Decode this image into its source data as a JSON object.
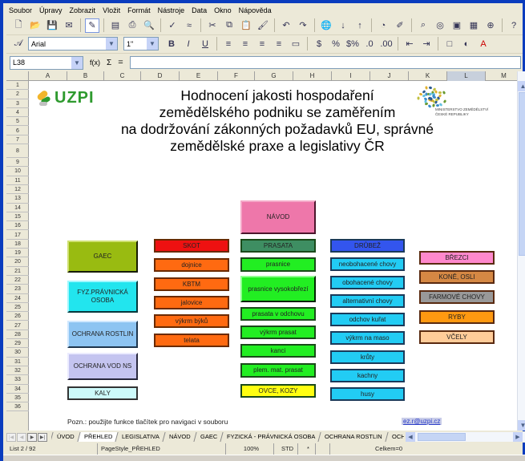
{
  "menu": [
    "Soubor",
    "Úpravy",
    "Zobrazit",
    "Vložit",
    "Formát",
    "Nástroje",
    "Data",
    "Okno",
    "Nápověda"
  ],
  "toolbar": {
    "standard_icons": [
      "new-icon",
      "open-icon",
      "save-icon",
      "email-icon",
      "edit-mode-icon",
      "export-pdf-icon",
      "print-icon",
      "page-preview-icon",
      "spellcheck-icon",
      "autospell-icon",
      "cut-icon",
      "copy-icon",
      "paste-icon",
      "format-paintbrush-icon",
      "undo-icon",
      "redo-icon",
      "hyperlink-icon",
      "sort-ascending-icon",
      "sort-descending-icon",
      "chart-icon",
      "draw-functions-icon",
      "find-icon",
      "navigator-icon",
      "gallery-icon",
      "datasources-icon",
      "zoom-icon",
      "help-icon"
    ],
    "font_name": "Arial",
    "font_size": "1\"",
    "format_icons": [
      "bold-icon",
      "italic-icon",
      "underline-icon",
      "align-left-icon",
      "align-center-icon",
      "align-right-icon",
      "justify-icon",
      "merge-cells-icon",
      "currency-icon",
      "percent-icon",
      "number-format-icon",
      "add-decimal-icon",
      "remove-decimal-icon",
      "decrease-indent-icon",
      "increase-indent-icon",
      "borders-icon",
      "background-color-icon",
      "font-color-icon"
    ]
  },
  "formula_bar": {
    "name_box": "L38",
    "func_label": "f(x)",
    "sum_label": "Σ",
    "eq_label": "=",
    "value": ""
  },
  "columns": [
    "A",
    "B",
    "C",
    "D",
    "E",
    "F",
    "G",
    "H",
    "I",
    "J",
    "K",
    "L",
    "M"
  ],
  "selected_column": "L",
  "rows": [
    "1",
    "2",
    "3",
    "4",
    "5",
    "6",
    "7",
    "8",
    "9",
    "10",
    "11",
    "12",
    "13",
    "14",
    "15",
    "16",
    "17",
    "18",
    "19",
    "20",
    "21",
    "22",
    "23",
    "24",
    "25",
    "26",
    "27",
    "28",
    "29",
    "30",
    "31",
    "32",
    "33",
    "34",
    "35",
    "36"
  ],
  "sheet": {
    "logo_text": "UZPI",
    "title_lines": [
      "Hodnocení jakosti hospodaření",
      "zemědělského podniku se zaměřením",
      "na dodržování zákonných  požadavků EU, správné",
      "zemědělské praxe a legislativy ČR"
    ],
    "ministry_lines": [
      "MINISTERSTVO ZEMĚDĚLSTVÍ",
      "ČESKÉ REPUBLIKY"
    ],
    "buttons": {
      "navod": "NÁVOD",
      "col1": [
        "GAEC",
        "FYZ.PRÁVNICKÁ OSOBA",
        "OCHRANA ROSTLIN",
        "OCHRANA VOD NS",
        "KALY"
      ],
      "col2": [
        "SKOT",
        "dojnice",
        "KBTM",
        "jalovice",
        "výkrm býků",
        "telata"
      ],
      "col3": [
        "PRASATA",
        "prasnice",
        "prasnice vysokobřezí",
        "prasata v odchovu",
        "výkrm prasat",
        "kanci",
        "plem. mat. prasat",
        "OVCE, KOZY"
      ],
      "col4": [
        "DRŮBEŽ",
        "neobohacené chovy",
        "obohacené chovy",
        "alternativní chovy",
        "odchov kuřat",
        "výkrm na maso",
        "krůty",
        "kachny",
        "husy"
      ],
      "col5": [
        "BŘEZCI",
        "KONĚ, OSLI",
        "FARMOVÉ CHOVY",
        "RYBY",
        "VČELY"
      ]
    },
    "note": "Pozn.: použijte funkce tlačítek pro navigaci v souboru",
    "email": "ez.r@uzpi.cz"
  },
  "colors": {
    "gaec": "#99bb11",
    "fyz": "#22e5ee",
    "ochrana_rostlin": "#8dc4f2",
    "ochrana_vod": "#c4c4f0",
    "kaly": "#cdfafa",
    "skot": "#ee1111",
    "orange": "#ff6a11",
    "navod": "#ee77aa",
    "prasata": "#3e8e62",
    "green": "#22ee22",
    "ovce": "#ffff11",
    "drubez": "#3355ee",
    "sky": "#22ccf4",
    "brezci": "#ff88cc",
    "kone": "#d58844",
    "farmove": "#999999",
    "ryby": "#ff9911",
    "vcely": "#ffcc99"
  },
  "tabs": [
    "ÚVOD",
    "PŘEHLED",
    "LEGISLATIVA",
    "NÁVOD",
    "GAEC",
    "FYZICKÁ - PRÁVNICKÁ OSOBA",
    "OCHRANA ROSTLIN",
    "OCHRANA"
  ],
  "active_tab": "PŘEHLED",
  "status": {
    "sheet": "List 2 / 92",
    "page_style": "PageStyle_PŘEHLED",
    "zoom": "100%",
    "mode": "STD",
    "modified": "*",
    "sum": "Celkem=0"
  }
}
